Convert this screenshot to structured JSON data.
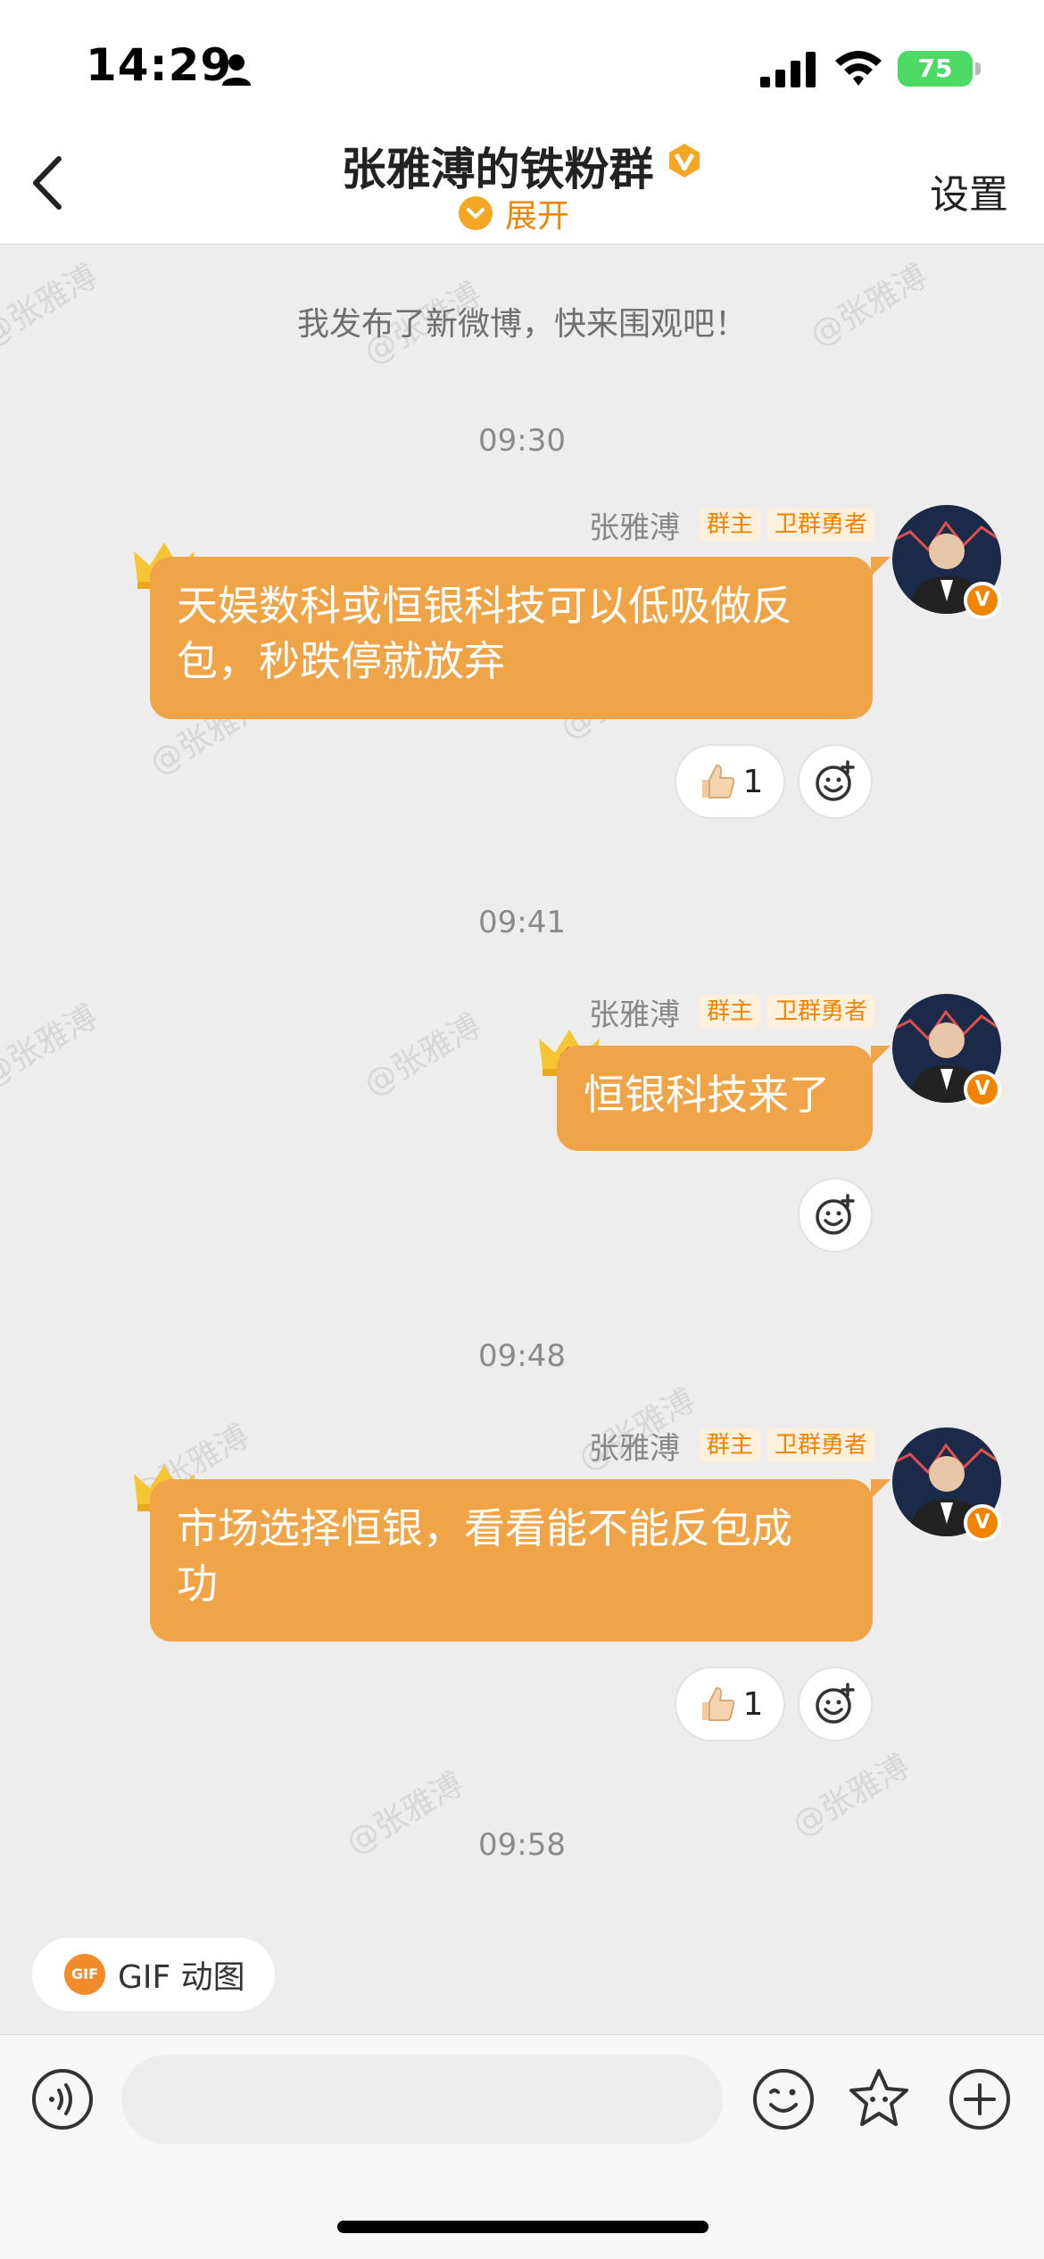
{
  "status_bar": {
    "time": "14:29",
    "battery": "75"
  },
  "nav": {
    "title": "张雅溥的铁粉群",
    "expand_label": "展开",
    "settings_label": "设置"
  },
  "chat": {
    "watermark": "@张雅溥",
    "system_message": "我发布了新微博，快来围观吧！",
    "messages": [
      {
        "time": "09:30",
        "sender": "张雅溥",
        "tag_owner": "群主",
        "tag_title": "卫群勇者",
        "text_line1": "天娱数科或恒银科技可以低吸做反",
        "text_line2": "包，秒跌停就放弃",
        "like_count": "1"
      },
      {
        "time": "09:41",
        "sender": "张雅溥",
        "tag_owner": "群主",
        "tag_title": "卫群勇者",
        "text_line1": "恒银科技来了"
      },
      {
        "time": "09:48",
        "sender": "张雅溥",
        "tag_owner": "群主",
        "tag_title": "卫群勇者",
        "text_line1": "市场选择恒银，看看能不能反包成",
        "text_line2": "功",
        "like_count": "1"
      }
    ],
    "last_time": "09:58"
  },
  "gif_button": {
    "icon_label": "GIF",
    "label": "GIF 动图"
  },
  "input": {
    "placeholder": ""
  }
}
